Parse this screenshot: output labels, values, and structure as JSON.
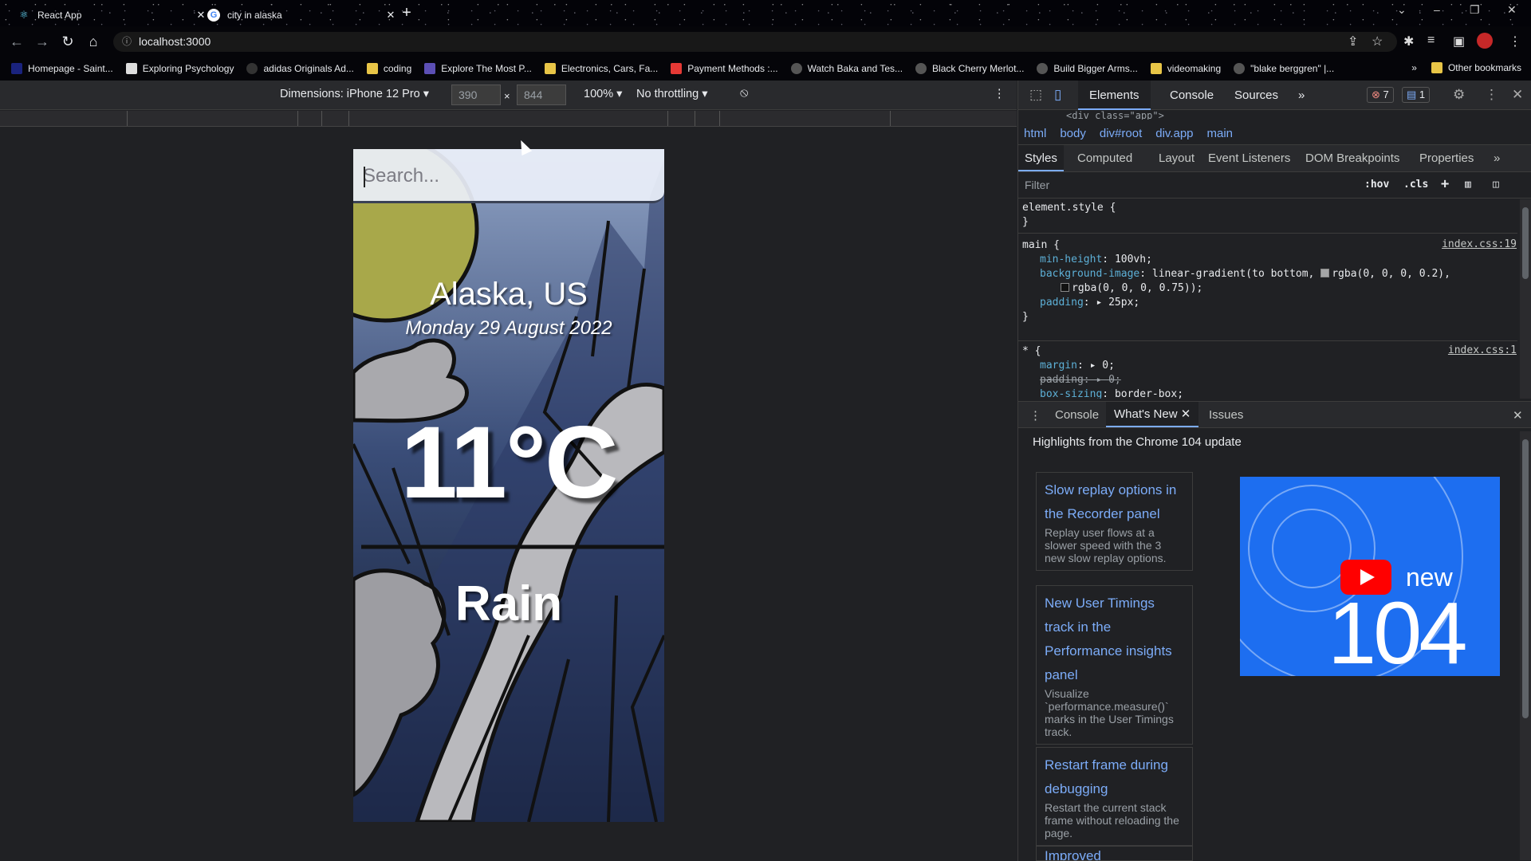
{
  "tabs": [
    {
      "title": "React App",
      "icon": "react-icon",
      "active": true
    },
    {
      "title": "city in alaska",
      "icon": "google-icon",
      "active": false
    }
  ],
  "address": {
    "url": "localhost:3000"
  },
  "bookmarks": [
    {
      "label": "Homepage - Saint...",
      "icon": "saint-icon",
      "color": "#1a237e"
    },
    {
      "label": "Exploring Psychology",
      "icon": "book-icon",
      "color": "#ddd"
    },
    {
      "label": "adidas Originals Ad...",
      "icon": "adidas-icon",
      "color": "#333"
    },
    {
      "label": "coding",
      "icon": "folder-icon",
      "color": "#e8c547"
    },
    {
      "label": "Explore The Most P...",
      "icon": "site-icon",
      "color": "#5c4fb5"
    },
    {
      "label": "Electronics, Cars, Fa...",
      "icon": "ebay-icon",
      "color": "#e8c547"
    },
    {
      "label": "Payment Methods :...",
      "icon": "card-icon",
      "color": "#e53935"
    },
    {
      "label": "Watch Baka and Tes...",
      "icon": "globe-icon",
      "color": "#555"
    },
    {
      "label": "Black Cherry Merlot...",
      "icon": "globe-icon",
      "color": "#555"
    },
    {
      "label": "Build Bigger Arms...",
      "icon": "globe-icon",
      "color": "#555"
    },
    {
      "label": "videomaking",
      "icon": "folder-icon",
      "color": "#e8c547"
    },
    {
      "label": "\"blake berggren\" |...",
      "icon": "globe-icon",
      "color": "#555"
    }
  ],
  "bookmarks_other": "Other bookmarks",
  "device_toolbar": {
    "dimensions_label": "Dimensions: iPhone 12 Pro",
    "width": "390",
    "height": "844",
    "times": "×",
    "zoom": "100%",
    "throttling": "No throttling"
  },
  "app": {
    "search_placeholder": "Search...",
    "location": "Alaska, US",
    "date": "Monday 29 August 2022",
    "temperature": "11°C",
    "weather": "Rain"
  },
  "devtools": {
    "tabs": [
      "Elements",
      "Console",
      "Sources"
    ],
    "more": "»",
    "errors_badge": "7",
    "messages_badge": "1",
    "partial_source": "<div class=\"app\">",
    "breadcrumbs": [
      "html",
      "body",
      "div#root",
      "div.app",
      "main"
    ],
    "subtabs": [
      "Styles",
      "Computed",
      "Layout",
      "Event Listeners",
      "DOM Breakpoints",
      "Properties"
    ],
    "filter_placeholder": "Filter",
    "hov": ":hov",
    "cls": ".cls",
    "rules": {
      "element_style_open": "element.style {",
      "close": "}",
      "main_selector": "main {",
      "main_src": "index.css:19",
      "min_height_prop": "min-height",
      "min_height_val": "100vh;",
      "bg_prop": "background-image",
      "bg_val1": "linear-gradient(to bottom,",
      "bg_val1b": "rgba(0, 0, 0, 0.2),",
      "bg_val2": "rgba(0, 0, 0, 0.75));",
      "padding_prop": "padding",
      "padding_val": "25px;",
      "star_selector": "* {",
      "star_src": "index.css:1",
      "margin_prop": "margin",
      "margin_val": "0;",
      "padding2_prop": "padding",
      "padding2_val": "0;",
      "boxsizing_prop": "box-sizing",
      "boxsizing_val": "border-box;"
    },
    "drawer_tabs": [
      "Console",
      "What's New",
      "Issues"
    ],
    "highlights_title": "Highlights from the Chrome 104 update",
    "cards": [
      {
        "title": "Slow replay options in the Recorder panel",
        "body": "Replay user flows at a slower speed with the 3 new slow replay options."
      },
      {
        "title": "New User Timings track in the Performance insights panel",
        "body": "Visualize `performance.measure()` marks in the User Timings track."
      },
      {
        "title": "Restart frame during debugging",
        "body": "Restart the current stack frame without reloading the page."
      },
      {
        "title": "Improved",
        "body": ""
      }
    ],
    "video": {
      "new_label": "new",
      "version": "104"
    }
  }
}
